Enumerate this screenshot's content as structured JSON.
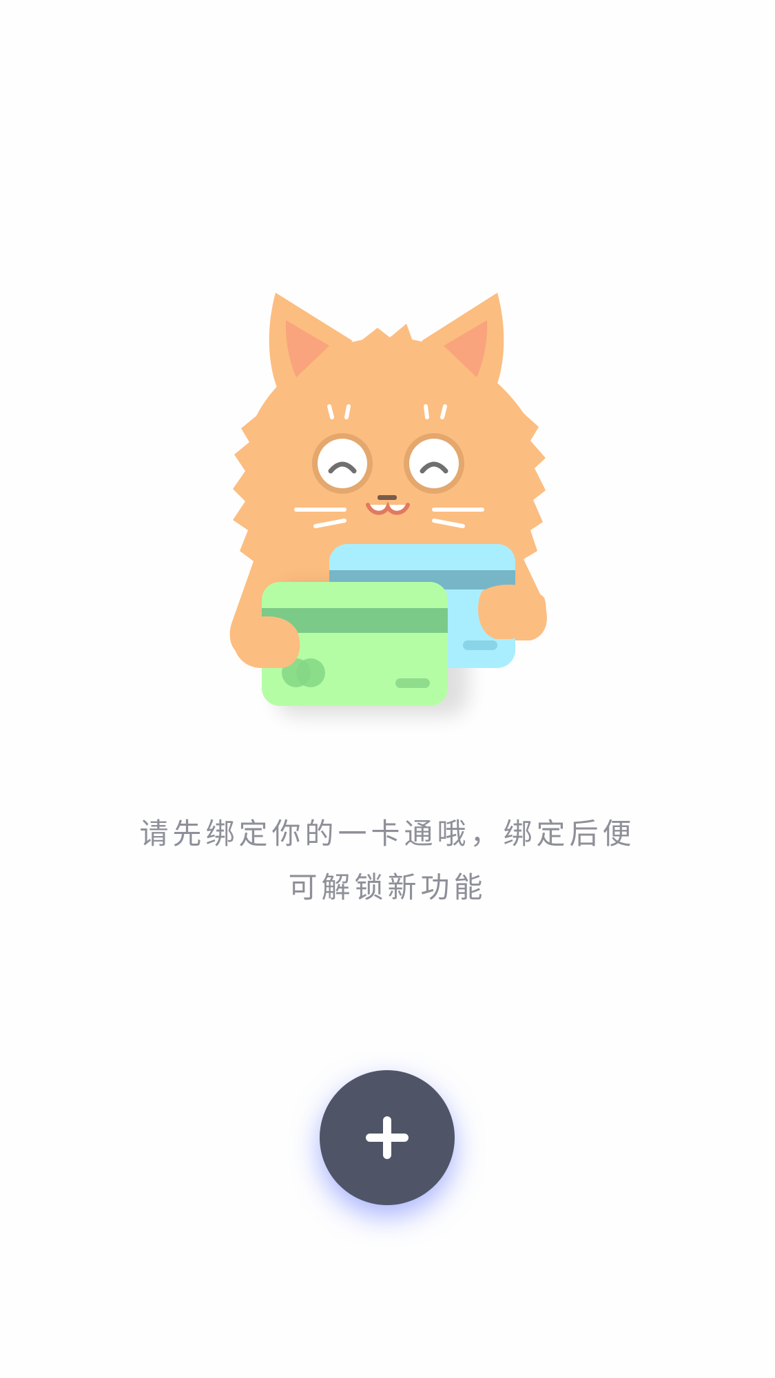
{
  "empty_state": {
    "message_line1": "请先绑定你的一卡通哦，绑定后便",
    "message_line2": "可解锁新功能",
    "illustration": "cat-holding-cards-illustration"
  },
  "add_button": {
    "icon": "plus-icon"
  },
  "colors": {
    "background": "#fefefe",
    "text": "#8e8f98",
    "button": "#4f5567",
    "button_glow": "#6278ff",
    "cat": "#fcbd80",
    "card_green": "#b5fda4",
    "card_blue": "#a9eefe"
  }
}
